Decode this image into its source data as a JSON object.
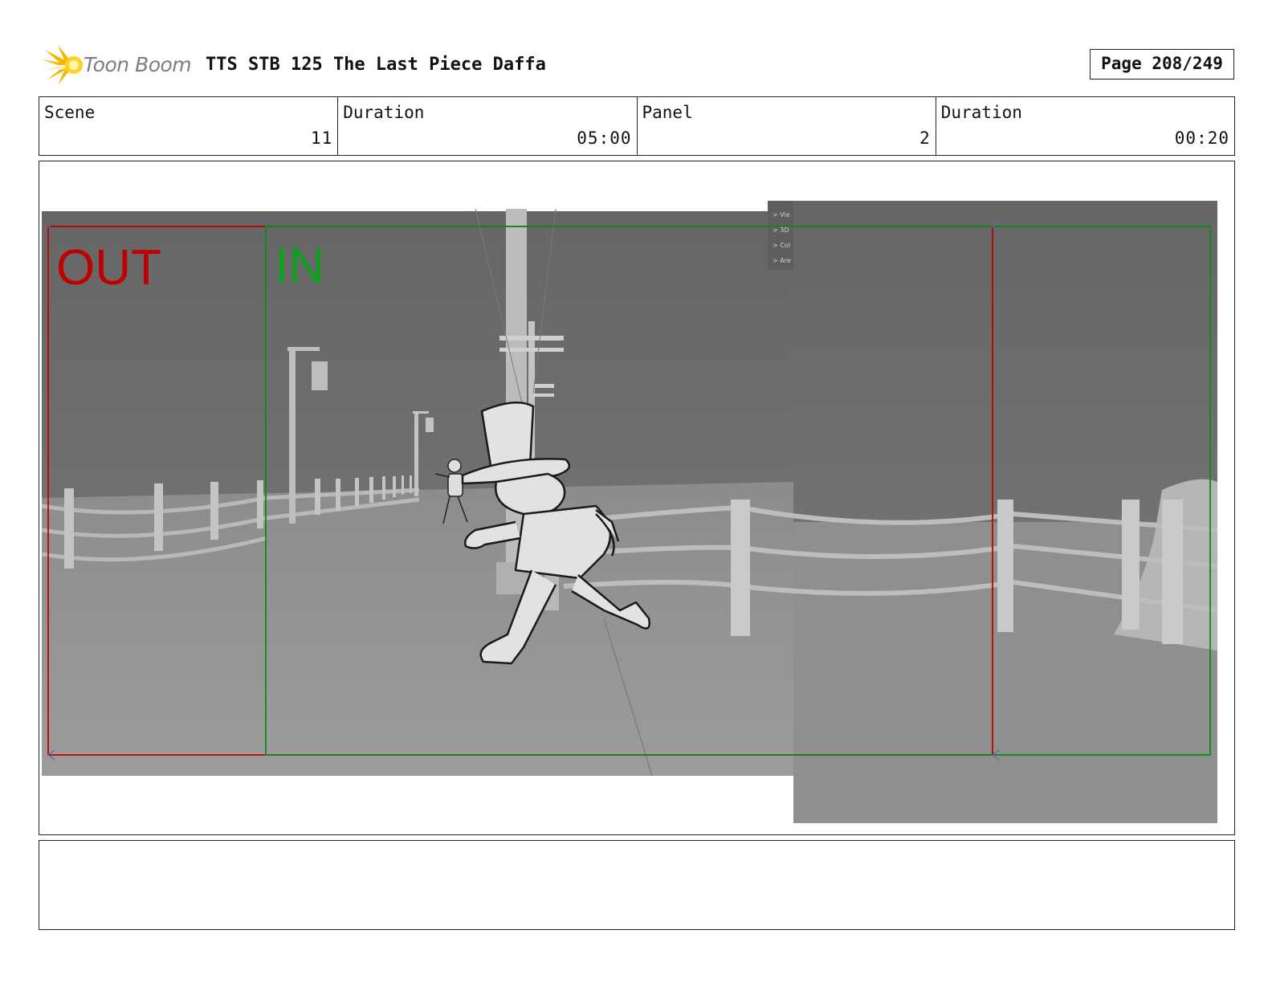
{
  "header": {
    "logo_text": "Toon Boom",
    "title": "TTS STB 125 The Last Piece Daffa",
    "page": "Page 208/249"
  },
  "info": {
    "scene_label": "Scene",
    "scene_value": "11",
    "scene_duration_label": "Duration",
    "scene_duration_value": "05:00",
    "panel_label": "Panel",
    "panel_value": "2",
    "panel_duration_label": "Duration",
    "panel_duration_value": "00:20"
  },
  "panel": {
    "out_label": "OUT",
    "in_label": "IN",
    "out_color": "#c00000",
    "in_color": "#0fa01e",
    "ui_menu": [
      "> Vie",
      "> 3D",
      "> Col",
      "> Are"
    ]
  },
  "caption": {
    "text": ""
  }
}
